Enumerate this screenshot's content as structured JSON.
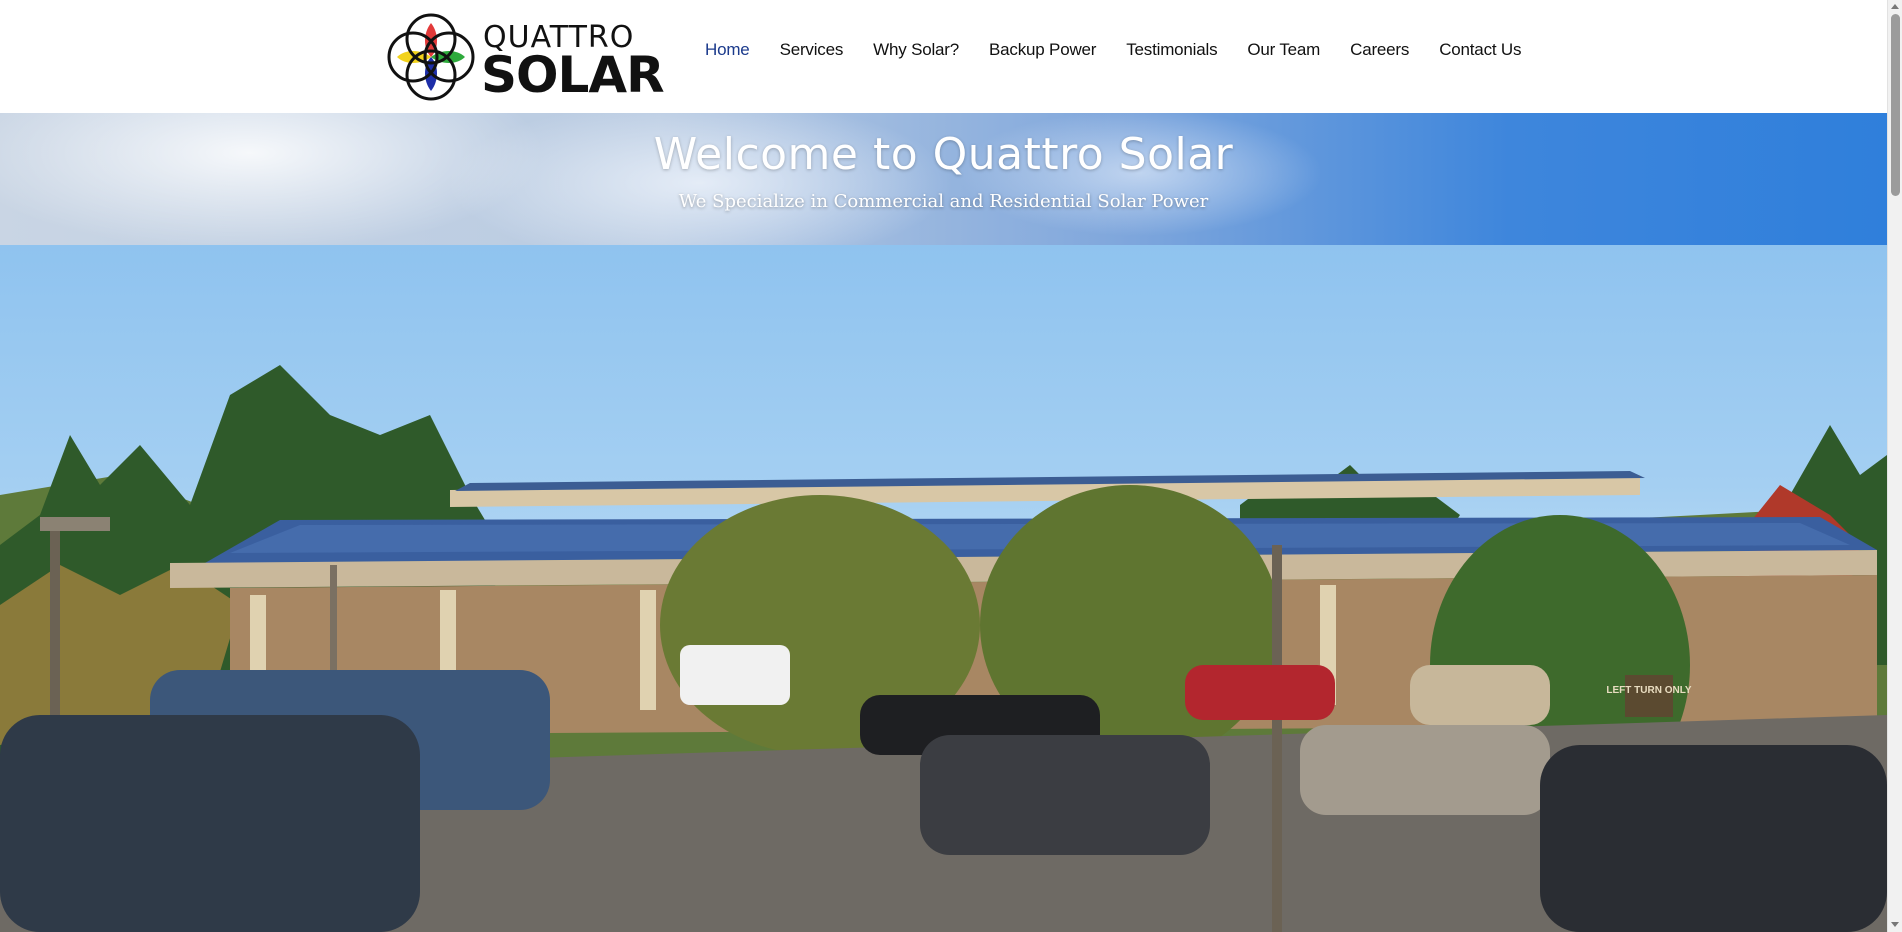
{
  "brand": {
    "name_line1": "QUATTRO",
    "name_line2": "SOLAR",
    "logo_colors": [
      "#e23a3a",
      "#2eaa3c",
      "#1d2ea8",
      "#f2d21c"
    ]
  },
  "nav": {
    "items": [
      {
        "label": "Home",
        "active": true
      },
      {
        "label": "Services",
        "active": false
      },
      {
        "label": "Why Solar?",
        "active": false
      },
      {
        "label": "Backup Power",
        "active": false
      },
      {
        "label": "Testimonials",
        "active": false
      },
      {
        "label": "Our Team",
        "active": false
      },
      {
        "label": "Careers",
        "active": false
      },
      {
        "label": "Contact Us",
        "active": false
      }
    ]
  },
  "banner": {
    "title": "Welcome to Quattro Solar",
    "subtitle": "We Specialize in Commercial and Residential Solar Power"
  },
  "hero": {
    "image_subject": "building-with-rooftop-solar-panels"
  },
  "sign": {
    "text": "LEFT TURN ONLY"
  },
  "colors": {
    "nav_active": "#1b3a8c",
    "nav_text": "#111111",
    "banner_text": "#ffffff"
  }
}
